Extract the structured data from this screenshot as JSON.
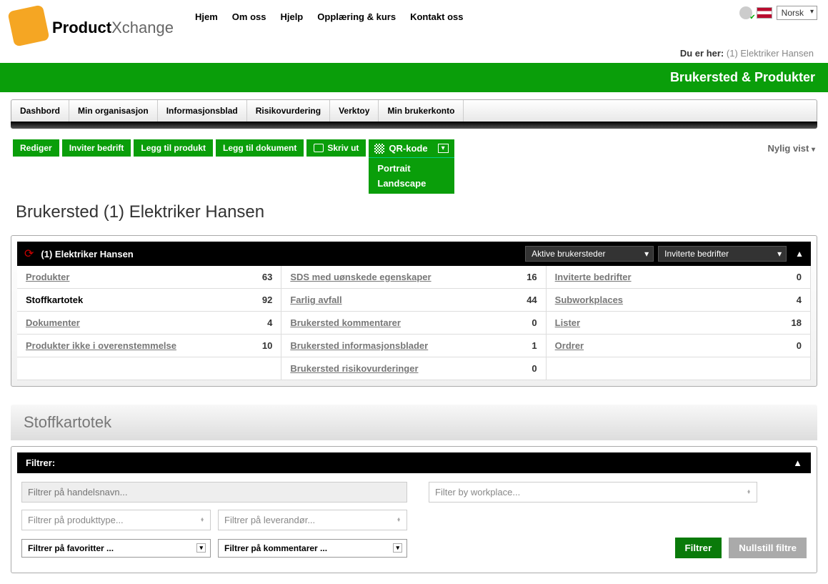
{
  "logo": {
    "bold": "Product",
    "light": "Xchange"
  },
  "top_nav": [
    "Hjem",
    "Om oss",
    "Hjelp",
    "Opplæring & kurs",
    "Kontakt oss"
  ],
  "language": "Norsk",
  "breadcrumb": {
    "label": "Du er her:",
    "value": "(1) Elektriker Hansen"
  },
  "green_bar": "Brukersted & Produkter",
  "main_nav": [
    "Dashbord",
    "Min organisasjon",
    "Informasjonsblad",
    "Risikovurdering",
    "Verktoy",
    "Min brukerkonto"
  ],
  "actions": {
    "edit": "Rediger",
    "invite": "Inviter bedrift",
    "add_product": "Legg til produkt",
    "add_document": "Legg til dokument",
    "print": "Skriv ut",
    "qr": "QR-kode",
    "qr_options": [
      "Portrait",
      "Landscape"
    ],
    "recent": "Nylig vist"
  },
  "page_title": "Brukersted (1) Elektriker Hansen",
  "panel": {
    "title": "(1) Elektriker Hansen",
    "select1": "Aktive brukersteder",
    "select2": "Inviterte bedrifter"
  },
  "stats": {
    "col1": [
      {
        "label": "Produkter",
        "val": "63",
        "active": false
      },
      {
        "label": "Stoffkartotek",
        "val": "92",
        "active": true
      },
      {
        "label": "Dokumenter",
        "val": "4",
        "active": false
      },
      {
        "label": "Produkter ikke i overenstemmelse",
        "val": "10",
        "active": false
      }
    ],
    "col2": [
      {
        "label": "SDS med uønskede egenskaper",
        "val": "16"
      },
      {
        "label": "Farlig avfall",
        "val": "44"
      },
      {
        "label": "Brukersted kommentarer",
        "val": "0"
      },
      {
        "label": "Brukersted informasjonsblader",
        "val": "1"
      },
      {
        "label": "Brukersted risikovurderinger",
        "val": "0"
      }
    ],
    "col3": [
      {
        "label": "Inviterte bedrifter",
        "val": "0"
      },
      {
        "label": "Subworkplaces",
        "val": "4"
      },
      {
        "label": "Lister",
        "val": "18"
      },
      {
        "label": "Ordrer",
        "val": "0"
      }
    ]
  },
  "section_title": "Stoffkartotek",
  "filter": {
    "header": "Filtrer:",
    "tradename": "Filtrer på handelsnavn...",
    "workplace": "Filter by workplace...",
    "producttype": "Filtrer på produkttype...",
    "supplier": "Filtrer på leverandør...",
    "favorites": "Filtrer på favoritter ...",
    "comments": "Filtrer på kommentarer ...",
    "btn_filter": "Filtrer",
    "btn_reset": "Nullstill filtre"
  }
}
